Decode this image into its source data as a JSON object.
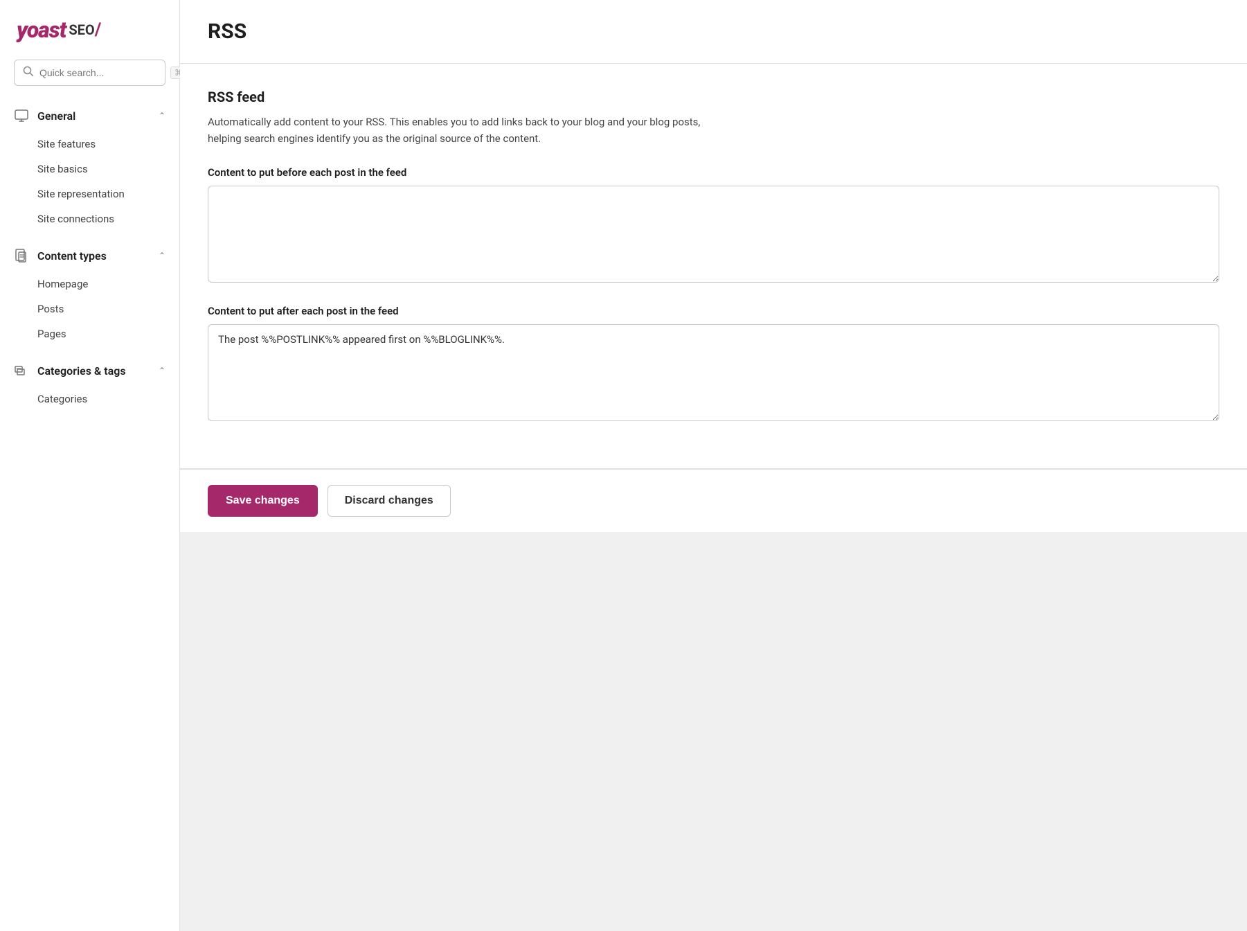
{
  "logo": {
    "yoast": "yoast",
    "seo": "SEO",
    "slash": "/"
  },
  "search": {
    "placeholder": "Quick search...",
    "shortcut": "⌘K"
  },
  "sidebar": {
    "sections": [
      {
        "id": "general",
        "icon": "monitor-icon",
        "label": "General",
        "expanded": true,
        "items": [
          {
            "id": "site-features",
            "label": "Site features"
          },
          {
            "id": "site-basics",
            "label": "Site basics"
          },
          {
            "id": "site-representation",
            "label": "Site representation"
          },
          {
            "id": "site-connections",
            "label": "Site connections"
          }
        ]
      },
      {
        "id": "content-types",
        "icon": "document-icon",
        "label": "Content types",
        "expanded": true,
        "items": [
          {
            "id": "homepage",
            "label": "Homepage"
          },
          {
            "id": "posts",
            "label": "Posts"
          },
          {
            "id": "pages",
            "label": "Pages"
          }
        ]
      },
      {
        "id": "categories-tags",
        "icon": "tag-icon",
        "label": "Categories & tags",
        "expanded": true,
        "items": [
          {
            "id": "categories",
            "label": "Categories"
          }
        ]
      }
    ]
  },
  "page": {
    "title": "RSS",
    "feed_section": {
      "title": "RSS feed",
      "description": "Automatically add content to your RSS. This enables you to add links back to your blog and your blog posts, helping search engines identify you as the original source of the content.",
      "before_label": "Content to put before each post in the feed",
      "before_value": "",
      "after_label": "Content to put after each post in the feed",
      "after_value": "The post %%POSTLINK%% appeared first on %%BLOGLINK%%."
    }
  },
  "footer": {
    "save_label": "Save changes",
    "discard_label": "Discard changes"
  }
}
